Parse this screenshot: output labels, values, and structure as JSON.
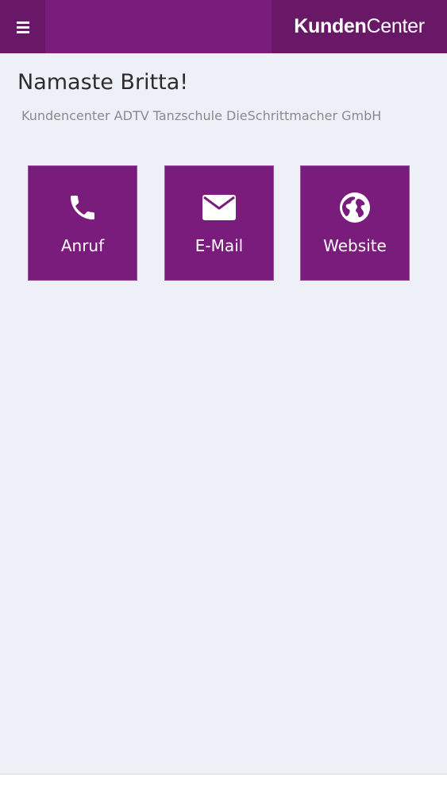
{
  "header": {
    "logo_bold": "Kunden",
    "logo_light": "Center",
    "menu_icon": "hamburger-menu-icon"
  },
  "main": {
    "greeting": "Namaste Britta!",
    "subtitle": "Kundencenter ADTV Tanzschule DieSchrittmacher GmbH"
  },
  "tiles": [
    {
      "label": "Anruf",
      "icon": "phone-icon"
    },
    {
      "label": "E-Mail",
      "icon": "envelope-icon"
    },
    {
      "label": "Website",
      "icon": "globe-icon"
    }
  ],
  "colors": {
    "primary": "#7a1c7c",
    "primary_dark": "#681867",
    "background": "#eef0f7"
  }
}
